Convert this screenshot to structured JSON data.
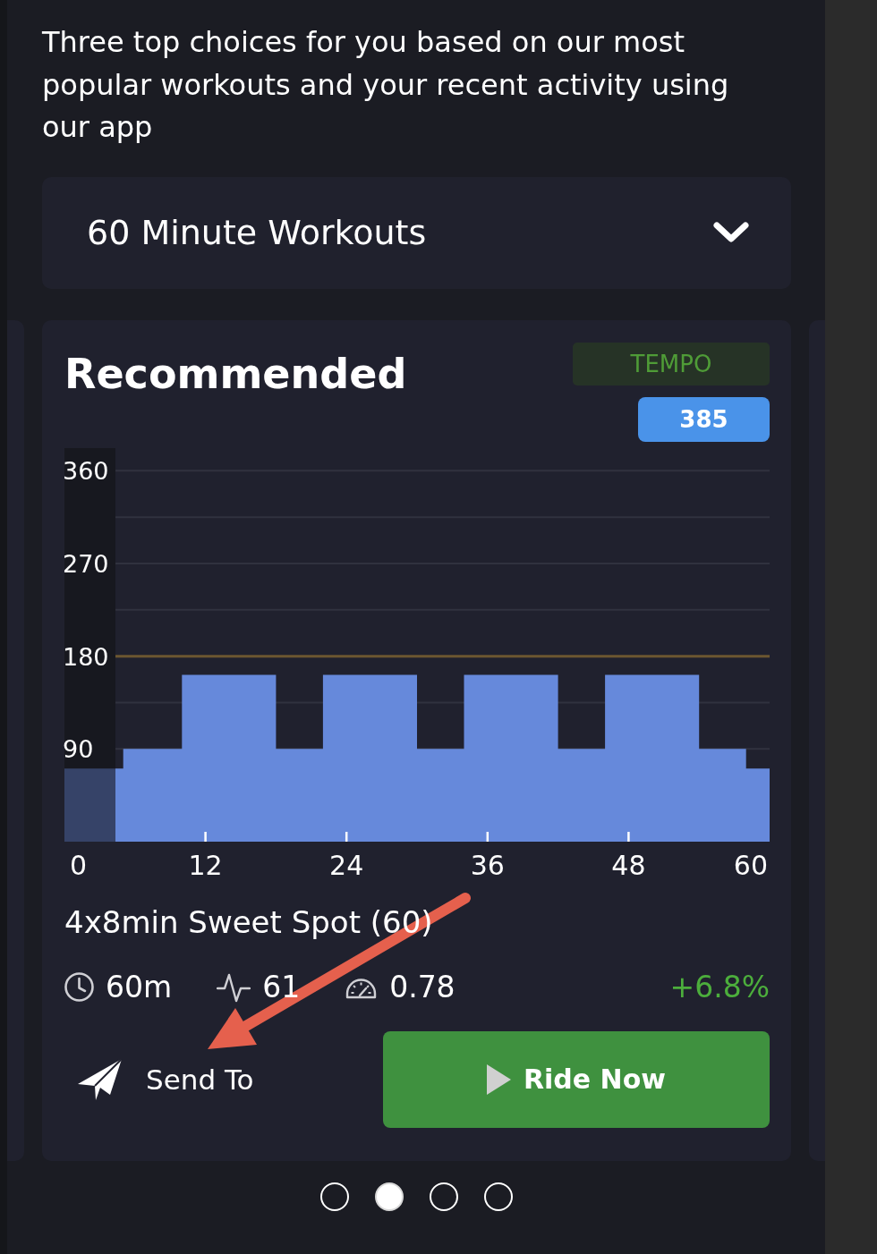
{
  "intro": {
    "text": "Three top choices for you based on our most popular workouts and your recent activity using our app"
  },
  "workout_filter": {
    "value": "60 Minute Workouts"
  },
  "card": {
    "title": "Recommended",
    "zone_badge": "TEMPO",
    "score_badge": "385",
    "chart_data": {
      "type": "area",
      "x": [
        0,
        5,
        5,
        10,
        10,
        18,
        18,
        22,
        22,
        30,
        30,
        34,
        34,
        42,
        42,
        46,
        46,
        54,
        54,
        58,
        58,
        60
      ],
      "values": [
        71,
        71,
        90,
        90,
        162,
        162,
        90,
        90,
        162,
        162,
        90,
        90,
        162,
        162,
        90,
        90,
        162,
        162,
        90,
        90,
        71,
        71
      ],
      "xlim": [
        0,
        60
      ],
      "ylim": [
        0,
        382
      ],
      "xticks": [
        0,
        12,
        24,
        36,
        48,
        60
      ],
      "yticks": [
        90,
        180,
        270,
        360
      ],
      "grid": true,
      "ref_lines": [
        {
          "axis": "y",
          "value": 180
        }
      ]
    },
    "workout_name": "4x8min Sweet Spot (60)",
    "stats": [
      {
        "kind": "clock",
        "value": "60m"
      },
      {
        "kind": "pulse",
        "value": "61"
      },
      {
        "kind": "gauge",
        "value": "0.78"
      }
    ],
    "change": "+6.8%",
    "actions": {
      "send": "Send To",
      "ride": "Ride Now"
    }
  },
  "pager": [
    {
      "selected": false
    },
    {
      "selected": true
    },
    {
      "selected": false
    },
    {
      "selected": false
    }
  ]
}
